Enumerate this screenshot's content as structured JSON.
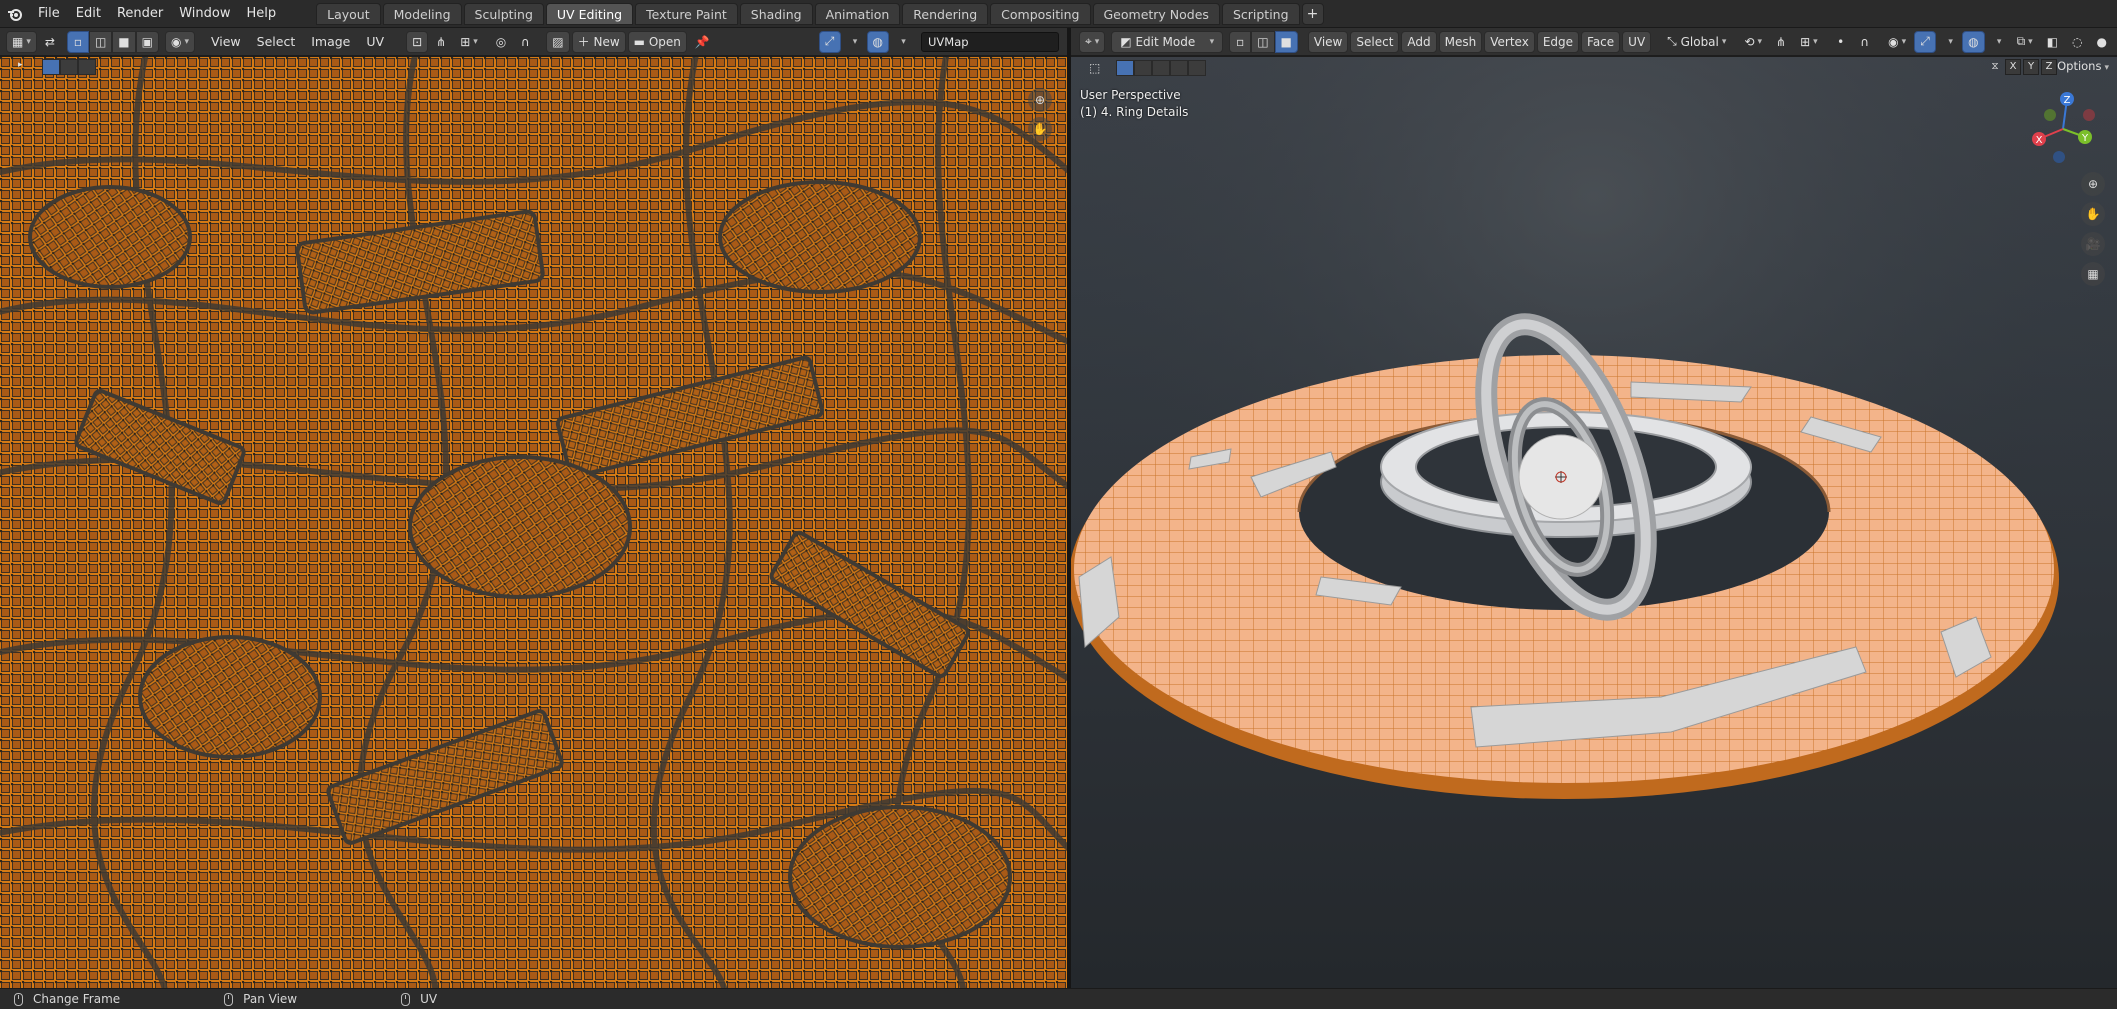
{
  "topbar": {
    "menus": [
      "File",
      "Edit",
      "Render",
      "Window",
      "Help"
    ],
    "workspaces": [
      "Layout",
      "Modeling",
      "Sculpting",
      "UV Editing",
      "Texture Paint",
      "Shading",
      "Animation",
      "Rendering",
      "Compositing",
      "Geometry Nodes",
      "Scripting"
    ],
    "active_workspace": "UV Editing",
    "add_workspace": "+"
  },
  "uv_editor": {
    "menus": [
      "View",
      "Select",
      "Image",
      "UV"
    ],
    "new_label": "New",
    "open_label": "Open",
    "uvmap_name": "UVMap"
  },
  "viewport": {
    "mode": "Edit Mode",
    "menus": [
      "View",
      "Select",
      "Add",
      "Mesh",
      "Vertex",
      "Edge",
      "Face",
      "UV"
    ],
    "transform_orientation": "Global",
    "info_line1": "User Perspective",
    "info_line2": "(1) 4. Ring Details",
    "axis_buttons": [
      "X",
      "Y",
      "Z"
    ],
    "options_label": "Options",
    "gizmo_labels": {
      "x": "X",
      "y": "Y",
      "z": "Z"
    }
  },
  "statusbar": {
    "items": [
      "Change Frame",
      "Pan View",
      "UV"
    ]
  },
  "colors": {
    "uv_orange": "#d57a14",
    "uv_dark_gap": "#3f3a33",
    "mesh_selected": "#f0a87a",
    "mesh_edges": "#c36a1c",
    "accent_blue": "#4772b3"
  }
}
